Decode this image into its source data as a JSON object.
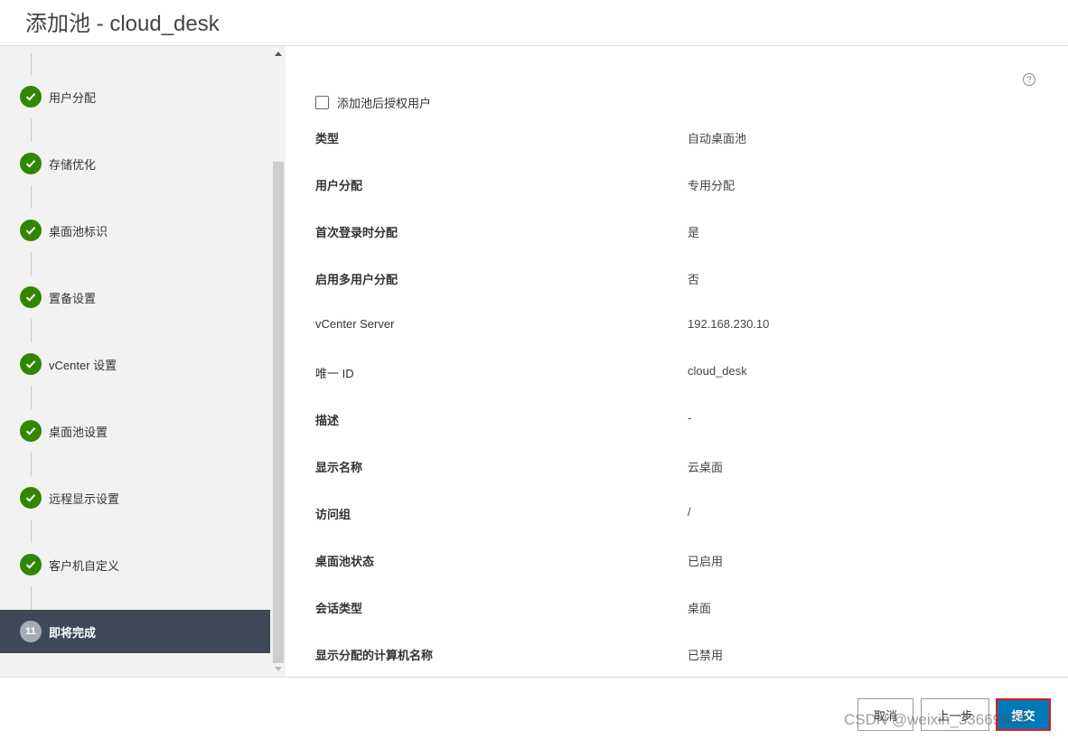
{
  "header": {
    "title": "添加池 - cloud_desk"
  },
  "sidebar": {
    "steps": [
      {
        "label": "用户分配",
        "status": "complete"
      },
      {
        "label": "存储优化",
        "status": "complete"
      },
      {
        "label": "桌面池标识",
        "status": "complete"
      },
      {
        "label": "置备设置",
        "status": "complete"
      },
      {
        "label": "vCenter 设置",
        "status": "complete"
      },
      {
        "label": "桌面池设置",
        "status": "complete"
      },
      {
        "label": "远程显示设置",
        "status": "complete"
      },
      {
        "label": "客户机自定义",
        "status": "complete"
      },
      {
        "label": "即将完成",
        "number": "11",
        "status": "active"
      }
    ],
    "check_icon": "check-icon",
    "complete_color": "#318700",
    "active_bg": "#3f4856"
  },
  "main": {
    "help_icon": "?",
    "entitle_checkbox_label": "添加池后授权用户",
    "entitle_checked": false,
    "details": [
      {
        "key": "类型",
        "value": "自动桌面池"
      },
      {
        "key": "用户分配",
        "value": "专用分配"
      },
      {
        "key": "首次登录时分配",
        "value": "是"
      },
      {
        "key": "启用多用户分配",
        "value": "否"
      },
      {
        "key": "vCenter Server",
        "value": "192.168.230.10"
      },
      {
        "key": "唯一 ID",
        "value": "cloud_desk"
      },
      {
        "key": "描述",
        "value": "-"
      },
      {
        "key": "显示名称",
        "value": "云桌面"
      },
      {
        "key": "访问组",
        "value": "/"
      },
      {
        "key": "桌面池状态",
        "value": "已启用"
      },
      {
        "key": "会话类型",
        "value": "桌面"
      },
      {
        "key": "显示分配的计算机名称",
        "value": "已禁用"
      }
    ]
  },
  "footer": {
    "cancel_label": "取消",
    "back_label": "上一步",
    "submit_label": "提交",
    "primary_color": "#0079b8"
  },
  "watermark": "CSDN @weixin_33669839"
}
